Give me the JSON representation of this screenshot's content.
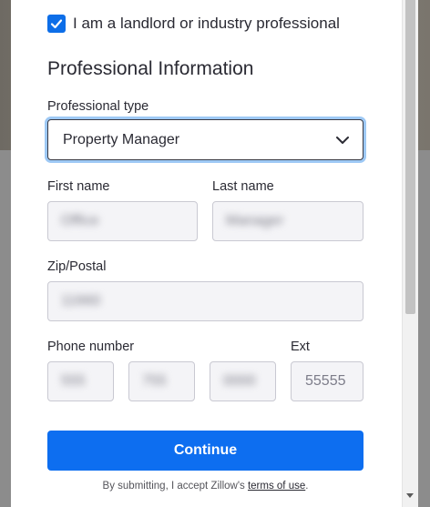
{
  "checkbox": {
    "label": "I am a landlord or industry professional",
    "checked": true
  },
  "section_title": "Professional Information",
  "professional_type": {
    "label": "Professional type",
    "value": "Property Manager"
  },
  "first_name": {
    "label": "First name",
    "value": "Office"
  },
  "last_name": {
    "label": "Last name",
    "value": "Manager"
  },
  "zip": {
    "label": "Zip/Postal",
    "value": "11660"
  },
  "phone": {
    "label": "Phone number",
    "part1": "555",
    "part2": "755",
    "part3": "0000"
  },
  "ext": {
    "label": "Ext",
    "placeholder": "55555"
  },
  "continue_label": "Continue",
  "terms": {
    "prefix": "By submitting, I accept Zillow's ",
    "link": "terms of use",
    "suffix": "."
  },
  "colors": {
    "accent": "#0d6ef0",
    "focus_ring": "#9ec9f5"
  }
}
